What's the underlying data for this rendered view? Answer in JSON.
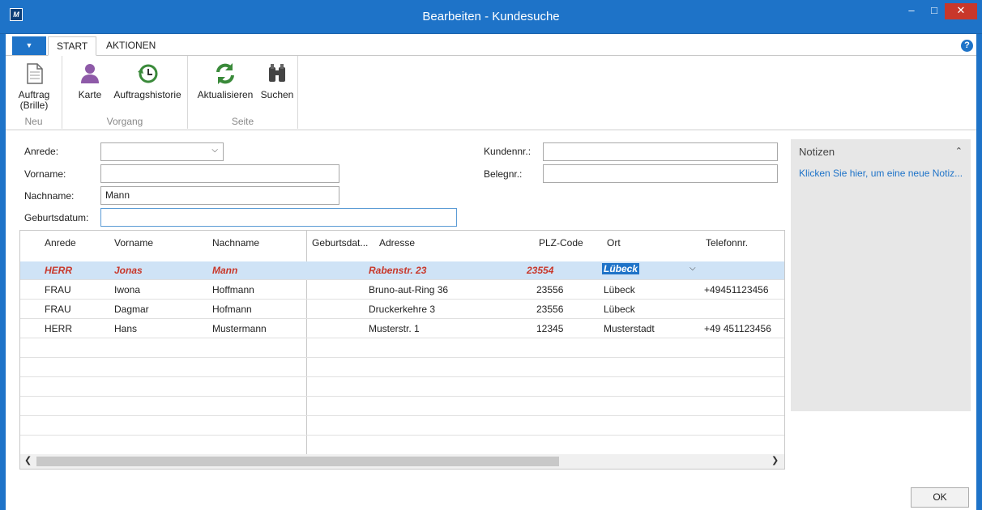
{
  "window": {
    "title": "Bearbeiten - Kundesuche",
    "logo": "M",
    "min": "–",
    "max": "□",
    "close": "✕"
  },
  "ribbon": {
    "tabs": [
      "START",
      "AKTIONEN"
    ],
    "help": "?",
    "groups": [
      {
        "label": "Neu",
        "buttons": [
          {
            "label": "Auftrag (Brille)",
            "icon": "document-icon"
          }
        ]
      },
      {
        "label": "Vorgang",
        "buttons": [
          {
            "label": "Karte",
            "icon": "person-icon"
          },
          {
            "label": "Auftragshistorie",
            "icon": "history-icon"
          }
        ]
      },
      {
        "label": "Seite",
        "buttons": [
          {
            "label": "Aktualisieren",
            "icon": "refresh-icon"
          },
          {
            "label": "Suchen",
            "icon": "binoculars-icon"
          }
        ]
      }
    ]
  },
  "form": {
    "anrede_label": "Anrede:",
    "anrede_value": "",
    "vorname_label": "Vorname:",
    "vorname_value": "",
    "nachname_label": "Nachname:",
    "nachname_value": "Mann",
    "geburtsdatum_label": "Geburtsdatum:",
    "geburtsdatum_value": "",
    "kundennr_label": "Kundennr.:",
    "kundennr_value": "",
    "belegnr_label": "Belegnr.:",
    "belegnr_value": ""
  },
  "grid": {
    "headers": [
      "Anrede",
      "Vorname",
      "Nachname",
      "Geburtsdat...",
      "Adresse",
      "PLZ-Code",
      "Ort",
      "Telefonnr."
    ],
    "rows": [
      [
        "HERR",
        "Jonas",
        "Mann",
        "",
        "Rabenstr. 23",
        "23554",
        "Lübeck",
        ""
      ],
      [
        "FRAU",
        "Iwona",
        "Hoffmann",
        "",
        "Bruno-aut-Ring 36",
        "23556",
        "Lübeck",
        "+49451123456"
      ],
      [
        "FRAU",
        "Dagmar",
        "Hofmann",
        "",
        "Druckerkehre 3",
        "23556",
        "Lübeck",
        ""
      ],
      [
        "HERR",
        "Hans",
        "Mustermann",
        "",
        "Musterstr. 1",
        "12345",
        "Musterstadt",
        "+49 451123456"
      ]
    ],
    "selected_row": 0
  },
  "notes": {
    "title": "Notizen",
    "link": "Klicken Sie hier, um eine neue Notiz..."
  },
  "footer": {
    "ok": "OK"
  },
  "colors": {
    "accent": "#1e73c8",
    "selected_text": "#c8372a",
    "selected_row": "#cfe3f6"
  }
}
